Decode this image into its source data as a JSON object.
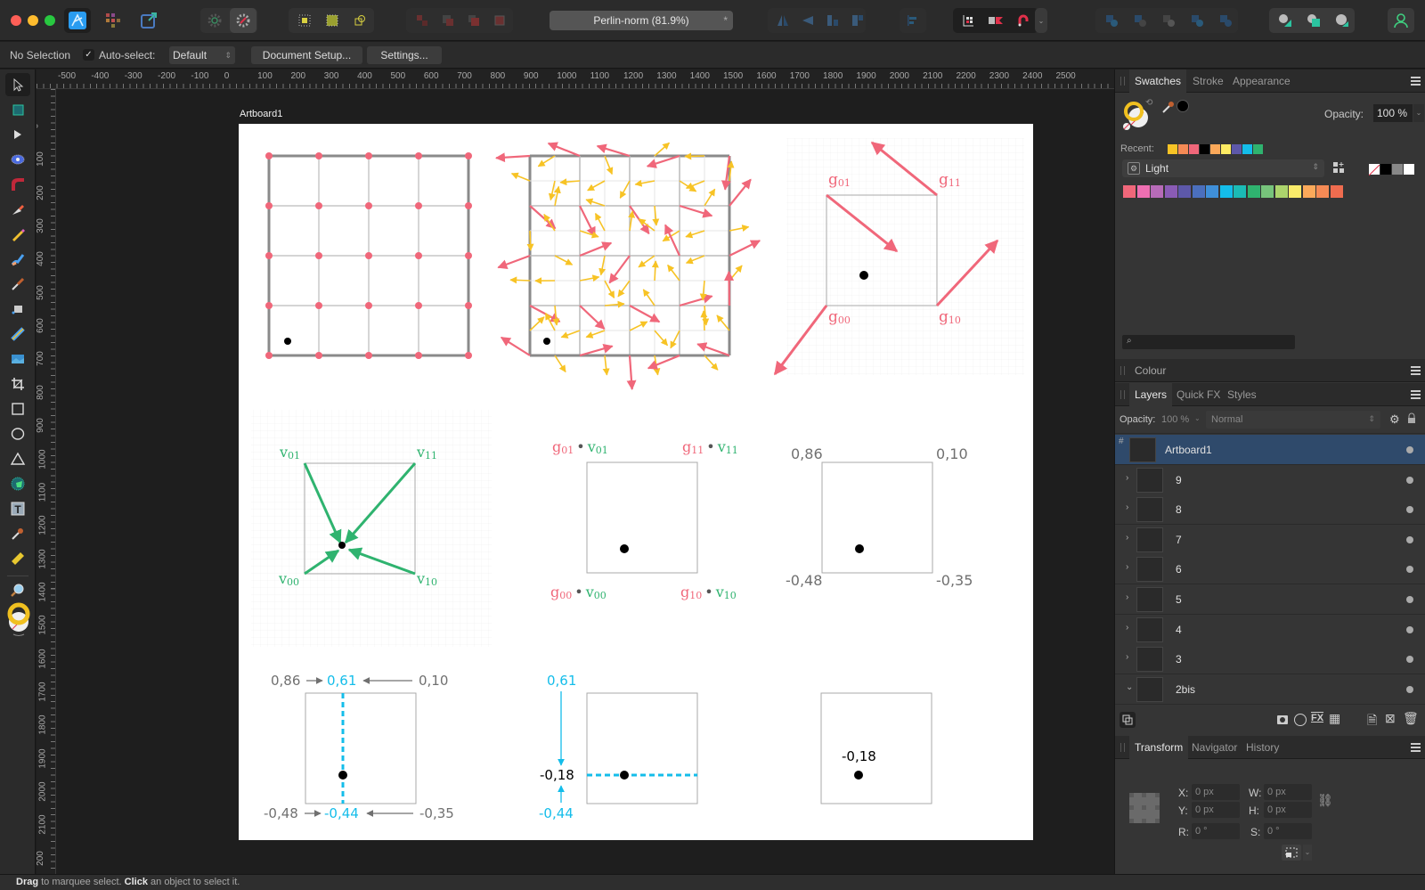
{
  "window": {
    "title": "Perlin-norm (81.9%)",
    "modified_indicator": "*"
  },
  "toolbar": {
    "personas": [
      "designer-persona",
      "pixel-persona",
      "export-persona"
    ],
    "snapping_icons": [
      "snapping-grid-icon",
      "snapping-toggle-icon",
      "snapping-magnet-icon"
    ]
  },
  "context_bar": {
    "selection": "No Selection",
    "auto_select_label": "Auto-select:",
    "auto_select_checked": true,
    "auto_select_value": "Default",
    "document_setup": "Document Setup...",
    "settings": "Settings..."
  },
  "rulers": {
    "unit": "px",
    "horizontal": [
      "-500",
      "-400",
      "-300",
      "-200",
      "-100",
      "0",
      "100",
      "200",
      "300",
      "400",
      "500",
      "600",
      "700",
      "800",
      "900",
      "1000",
      "1100",
      "1200",
      "1300",
      "1400",
      "1500",
      "1600",
      "1700",
      "1800",
      "1900",
      "2000",
      "2100",
      "2200",
      "2300",
      "2400",
      "2500"
    ],
    "vertical": [
      "0",
      "100",
      "200",
      "300",
      "400",
      "500",
      "600",
      "700",
      "800",
      "900",
      "1000",
      "1100",
      "1200",
      "1300",
      "1400",
      "1500",
      "1600",
      "1700",
      "1800",
      "1900",
      "2000",
      "2100",
      "200"
    ]
  },
  "artboard": {
    "name": "Artboard1",
    "colors": {
      "gradient": "#f0677a",
      "gradient_minor": "#f7c325",
      "vector": "#2fb36f",
      "interp": "#14bdea",
      "grid": "#999999",
      "value_text": "#707070"
    },
    "fig5": {
      "labels": {
        "g01": "g",
        "g01_sub": "01",
        "v01": "v",
        "v01_sub": "01",
        "g11": "g",
        "g11_sub": "11",
        "v11": "v",
        "v11_sub": "11",
        "g00": "g",
        "g00_sub": "00",
        "v00": "v",
        "v00_sub": "00",
        "g10": "g",
        "g10_sub": "10",
        "v10": "v",
        "v10_sub": "10",
        "dot": "•"
      }
    },
    "gradient_labels": {
      "g01": "g",
      "g01_sub": "01",
      "g11": "g",
      "g11_sub": "11",
      "g00": "g",
      "g00_sub": "00",
      "g10": "g",
      "g10_sub": "10"
    },
    "vector_labels": {
      "v01": "v",
      "v01_sub": "01",
      "v11": "v",
      "v11_sub": "11",
      "v00": "v",
      "v00_sub": "00",
      "v10": "v",
      "v10_sub": "10"
    },
    "dot_products": {
      "tl": "0,86",
      "tr": "0,10",
      "bl": "-0,48",
      "br": "-0,35"
    },
    "lerp_x": {
      "top_left": "0,86",
      "top_mid": "0,61",
      "top_right": "0,10",
      "bot_left": "-0,48",
      "bot_mid": "-0,44",
      "bot_right": "-0,35"
    },
    "lerp_y": {
      "top": "0,61",
      "mid": "-0,18",
      "bot": "-0,44"
    },
    "result": "-0,18"
  },
  "swatches_panel": {
    "tabs": [
      "Swatches",
      "Stroke",
      "Appearance"
    ],
    "active_tab": "Swatches",
    "opacity_label": "Opacity:",
    "opacity_value": "100 %",
    "recent_label": "Recent:",
    "recent_colors": [
      "#f7c325",
      "#f58a55",
      "#f0677a",
      "#000000",
      "#fba95a",
      "#fdeb63",
      "#5d58a9",
      "#14bdea",
      "#2fb36f"
    ],
    "palette_name": "Light",
    "palette_colors": [
      "#f0677a",
      "#ee6fb2",
      "#b76bb8",
      "#8a5bb5",
      "#5d58a9",
      "#4b6fbd",
      "#3f8fd8",
      "#14bdea",
      "#1bbbb5",
      "#2fb36f",
      "#77c47b",
      "#acd46c",
      "#f9eb6a",
      "#fba95a",
      "#f58a55",
      "#ef6c4f"
    ],
    "search_placeholder": ""
  },
  "colour_panel": {
    "title": "Colour"
  },
  "layers_panel": {
    "tabs": [
      "Layers",
      "Quick FX",
      "Styles"
    ],
    "active_tab": "Layers",
    "opacity_label": "Opacity:",
    "opacity_value": "100 %",
    "blend_mode": "Normal",
    "layers": [
      {
        "name": "Artboard1",
        "selected": true,
        "expanded": true
      },
      {
        "name": "9",
        "selected": false,
        "expanded": false
      },
      {
        "name": "8",
        "selected": false,
        "expanded": false
      },
      {
        "name": "7",
        "selected": false,
        "expanded": false
      },
      {
        "name": "6",
        "selected": false,
        "expanded": false
      },
      {
        "name": "5",
        "selected": false,
        "expanded": false
      },
      {
        "name": "4",
        "selected": false,
        "expanded": false
      },
      {
        "name": "3",
        "selected": false,
        "expanded": false
      },
      {
        "name": "2bis",
        "selected": false,
        "expanded": true
      }
    ]
  },
  "transform_panel": {
    "tabs": [
      "Transform",
      "Navigator",
      "History"
    ],
    "active_tab": "Transform",
    "x_label": "X:",
    "x_value": "0 px",
    "y_label": "Y:",
    "y_value": "0 px",
    "w_label": "W:",
    "w_value": "0 px",
    "h_label": "H:",
    "h_value": "0 px",
    "r_label": "R:",
    "r_value": "0 °",
    "s_label": "S:",
    "s_value": "0 °"
  },
  "status": {
    "drag": "Drag",
    "drag_text": " to marquee select. ",
    "click": "Click",
    "click_text": " an object to select it."
  }
}
